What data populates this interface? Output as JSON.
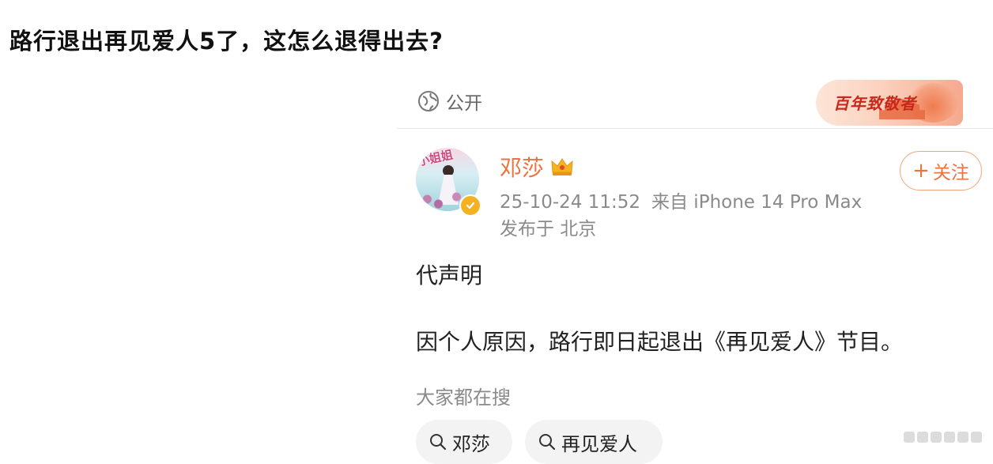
{
  "page": {
    "title": "路行退出再见爱人5了，这怎么退得出去?"
  },
  "post": {
    "visibility_label": "公开",
    "banner_text": "百年致敬者",
    "avatar_text": "小姐姐",
    "username": "邓莎",
    "timestamp": "25-10-24 11:52",
    "source": "来自 iPhone 14 Pro Max",
    "location": "发布于 北京",
    "follow_label": "关注",
    "content": {
      "line1": "代声明",
      "line2": "因个人原因，路行即日起退出《再见爱人》节目。"
    }
  },
  "hot_search": {
    "label": "大家都在搜",
    "chips": [
      "邓莎",
      "再见爱人"
    ]
  },
  "colors": {
    "username": "#eb7340",
    "follow_border": "#f2a57d",
    "muted_text": "#8a8a8a",
    "chip_bg": "#f3f3f3",
    "verified_badge": "#f4b223"
  },
  "icons": [
    "globe-icon",
    "crown-icon",
    "verified-icon",
    "plus-icon",
    "search-icon",
    "more-icon"
  ]
}
